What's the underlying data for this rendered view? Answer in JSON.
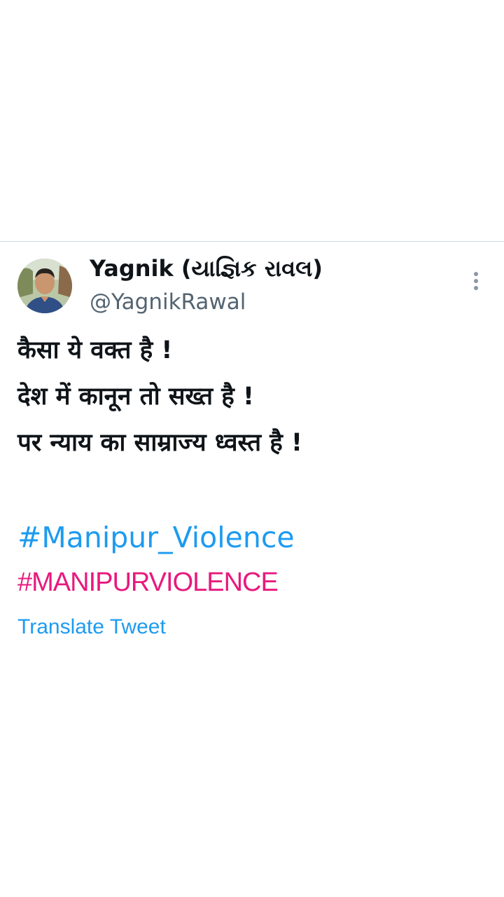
{
  "tweet": {
    "author": {
      "display_name": "Yagnik (યાજ્ઞિક રાવલ)",
      "handle": "@YagnikRawal",
      "avatar_icon": "user-photo-avatar"
    },
    "more_icon": "vertical-ellipsis-icon",
    "text_lines": [
      "कैसा ये वक्त है !",
      "देश में कानून तो सख्त है !",
      "पर न्याय का साम्राज्य ध्वस्त है !"
    ],
    "hashtags": [
      "#Manipur_Violence",
      "#MANIPURVIOLENCE"
    ],
    "translate_label": "Translate Tweet"
  },
  "colors": {
    "link": "#1d9bf0",
    "hashtag_pink": "#e8197d",
    "handle_gray": "#536471",
    "text": "#0f1419",
    "divider": "#cfd9de"
  }
}
